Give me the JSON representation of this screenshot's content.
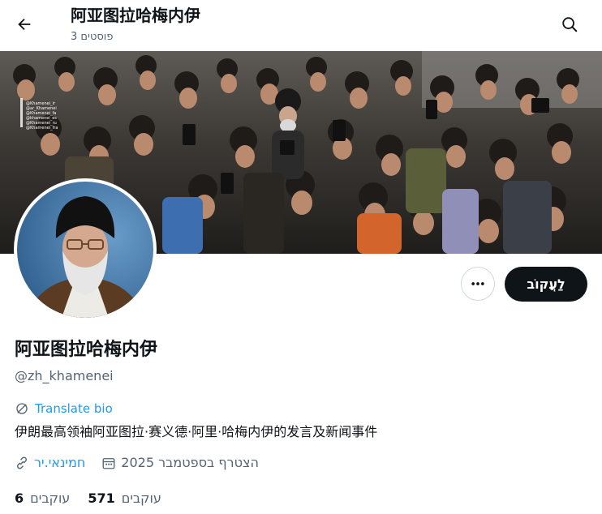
{
  "header": {
    "title": "阿亚图拉哈梅内伊",
    "post_count": "3 פוסטים",
    "back_icon": "arrow-left-icon",
    "search_icon": "search-icon"
  },
  "banner": {
    "watermark_lines": [
      "@Khamenei_ir",
      "@ar_Khamenei",
      "@Khamenei_fa",
      "@khamenei_es",
      "@Khamenei_ru",
      "@Khamenei_fra"
    ]
  },
  "profile": {
    "follow_label": "לַעֲקוֹב",
    "more_icon": "more-dots-icon",
    "name": "阿亚图拉哈梅内伊",
    "handle": "@zh_khamenei",
    "translate_label": "Translate bio",
    "bio": "伊朗最高领袖阿亚图拉·赛义德·阿里·哈梅内伊的发言及新闻事件",
    "website": "חמינאי.יר",
    "joined": "הצטרף בספטמבר 2025"
  },
  "stats": {
    "following_count": "6",
    "following_label": "עוקבים",
    "followers_count": "571",
    "followers_label": "עוקבים"
  },
  "colors": {
    "accent": "#1d9bf0",
    "text": "#0f1419",
    "muted": "#536471"
  }
}
